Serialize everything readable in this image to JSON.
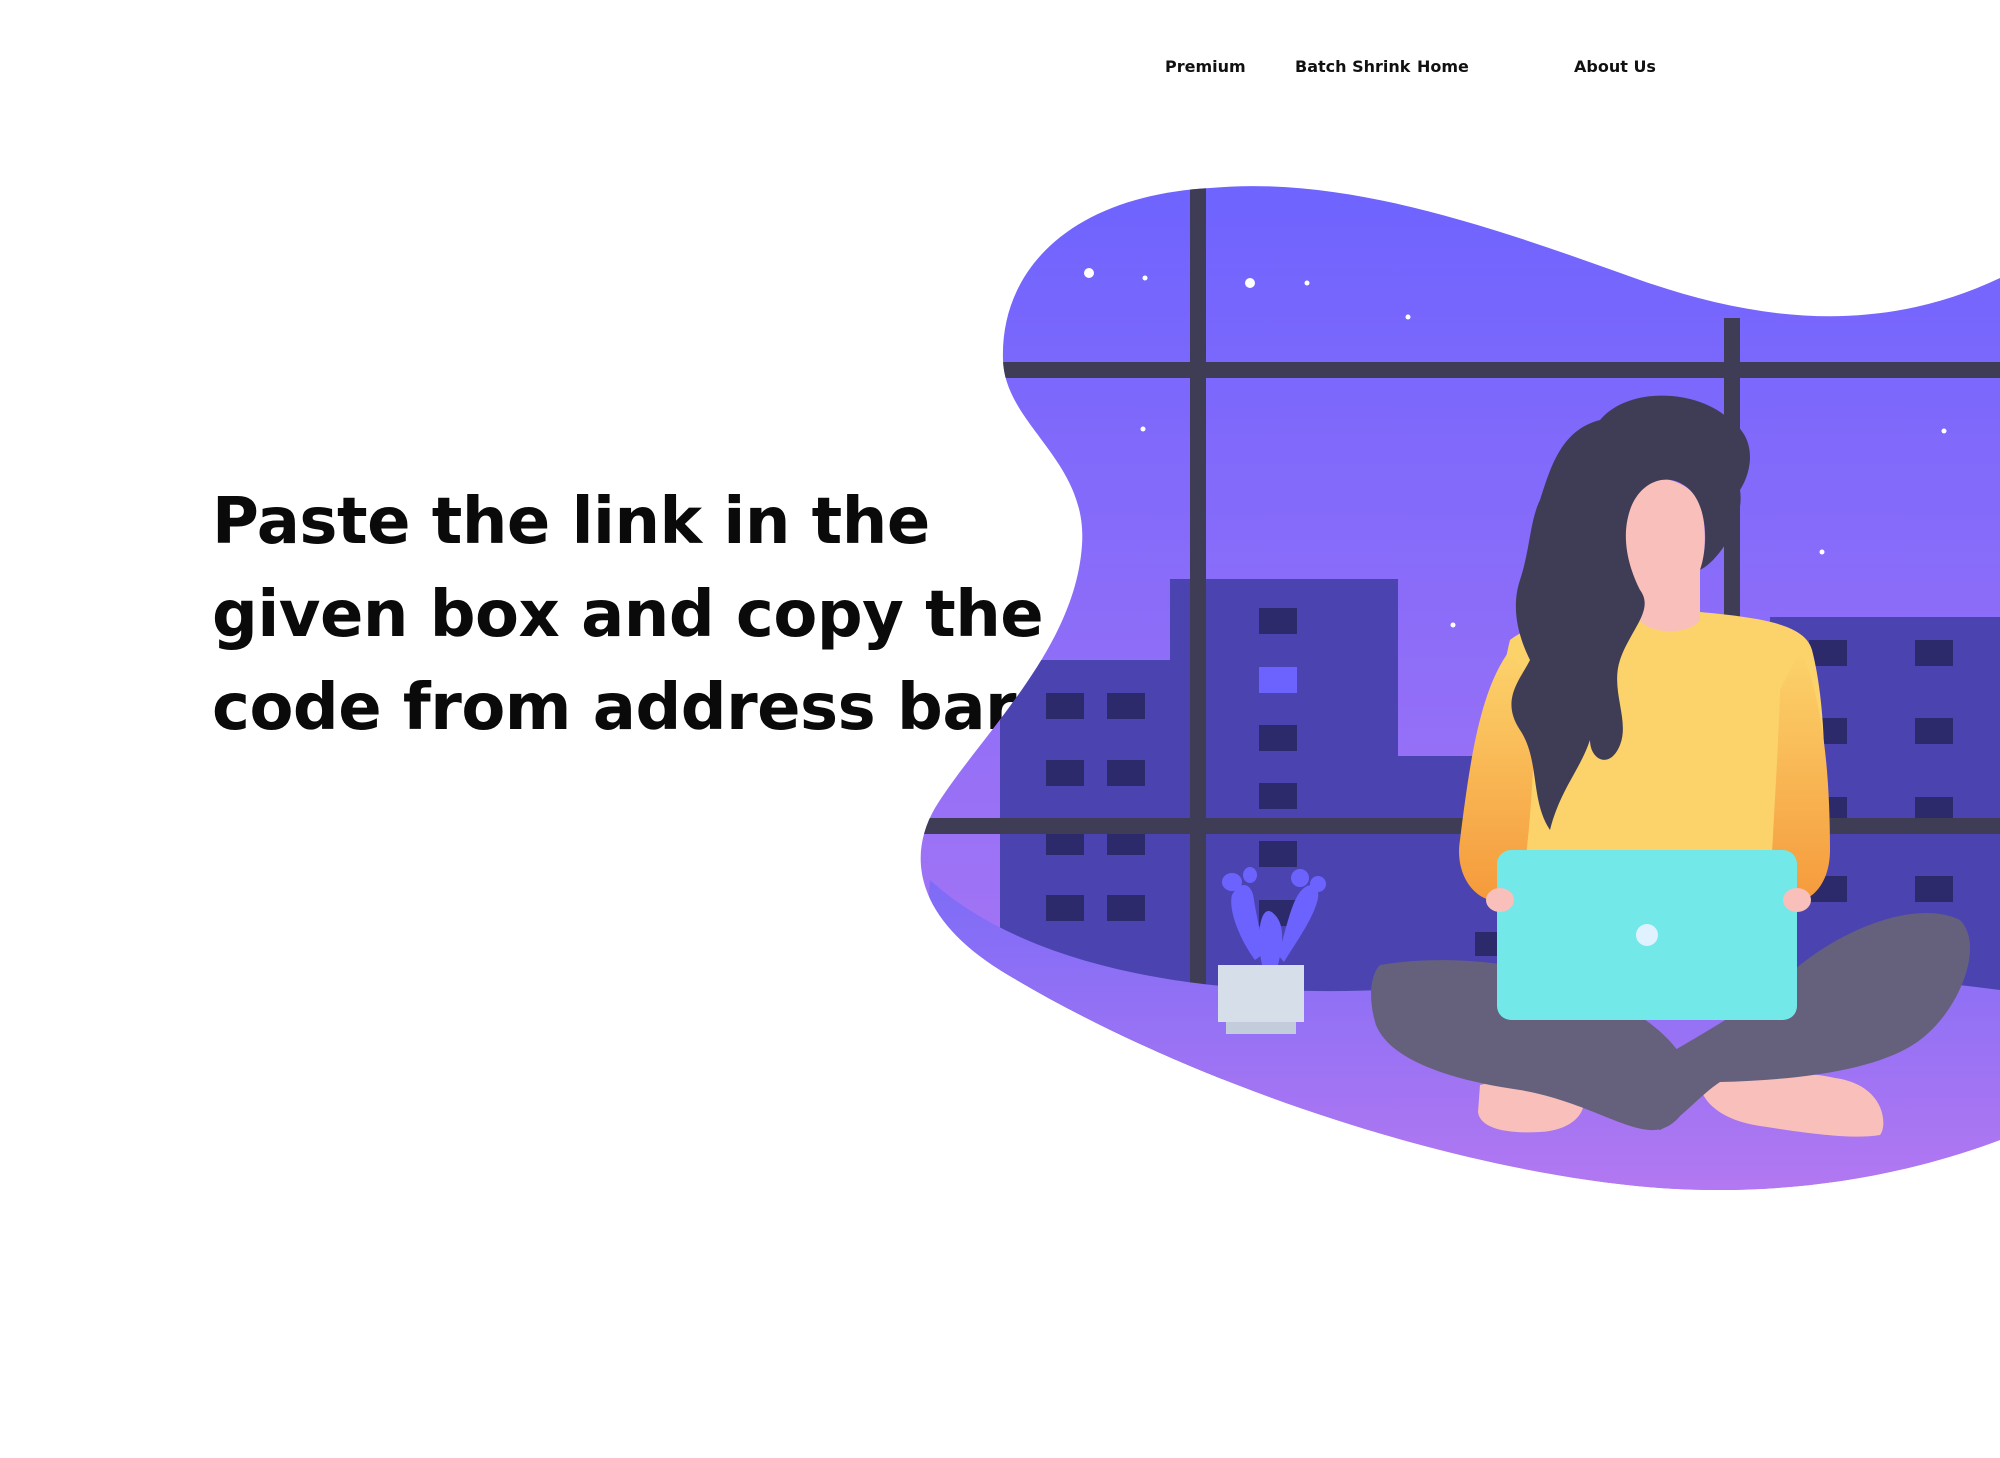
{
  "nav": {
    "premium": "Premium",
    "batch_shrink": "Batch Shrink",
    "home": "Home",
    "about": "About Us"
  },
  "hero": {
    "headline": "Paste the link in the given box and copy the code from address bar."
  },
  "illustration": {
    "description_colors": {
      "sky_top": "#6c63ff",
      "sky_bottom": "#b275f0",
      "buildings": "#4b44b0",
      "windows_dark": "#2c2a6b",
      "window_frame": "#3f3d56",
      "laptop": "#72e8e8",
      "sweater": "#fcd36b",
      "sweater_stripe": "#f59a3c",
      "pants": "#65617d",
      "skin": "#f9bfbb",
      "hair": "#3f3d56",
      "pot": "#d6deea",
      "cactus": "#6c63ff"
    }
  }
}
